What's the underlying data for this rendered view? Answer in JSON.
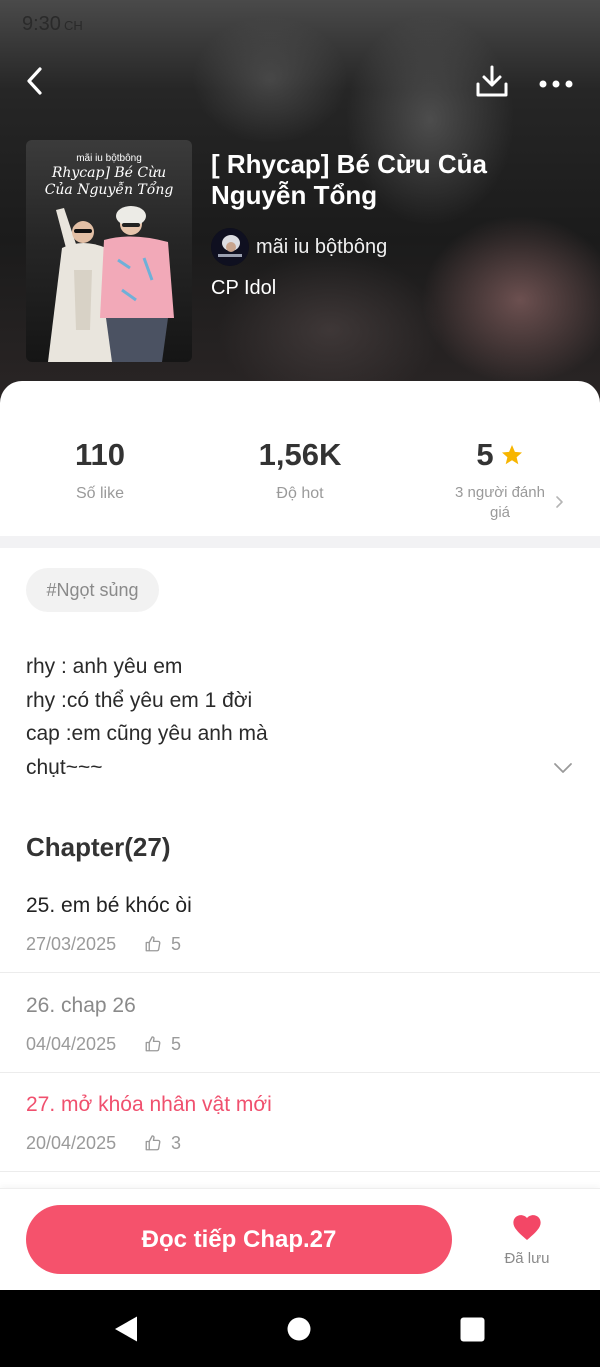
{
  "status_bar": {
    "time": "9:30",
    "period": "CH"
  },
  "header": {
    "title": "[ Rhycap] Bé Cừu Của Nguyễn Tổng",
    "author": "mãi iu bộtbông",
    "category": "CP Idol",
    "cover": {
      "author_line": "mãi iu bộtbông",
      "title_line1": "Rhycap] Bé Cừu",
      "title_line2": "Của Nguyễn Tổng"
    }
  },
  "stats": [
    {
      "value": "110",
      "label": "Số like"
    },
    {
      "value": "1,56K",
      "label": "Độ hot"
    },
    {
      "value": "5",
      "label": "3 người đánh giá"
    }
  ],
  "tags": [
    "#Ngọt sủng"
  ],
  "description": [
    "rhy : anh yêu em",
    "rhy :có thể yêu em 1 đời",
    "cap :em cũng yêu anh mà",
    "chụt~~~"
  ],
  "chapter_section": {
    "heading": "Chapter(27)"
  },
  "chapters": [
    {
      "title": "25. em bé khóc òi",
      "date": "27/03/2025",
      "likes": "5",
      "title_color": "#222222"
    },
    {
      "title": "26. chap 26",
      "date": "04/04/2025",
      "likes": "5",
      "title_color": "#8a8a8a"
    },
    {
      "title": "27. mở khóa nhân vật mới",
      "date": "20/04/2025",
      "likes": "3",
      "title_color": "#f0506e"
    }
  ],
  "bottom_bar": {
    "continue_button": "Đọc tiếp Chap.27",
    "saved_label": "Đã lưu"
  },
  "theme": {
    "accent": "#f5526c",
    "star": "#f7b500",
    "heart": "#f34766",
    "text": "#333333",
    "muted": "#9a9a9a"
  },
  "icons": {
    "back": "back-arrow-icon",
    "download": "download-icon",
    "more": "more-dots-icon",
    "rating": "star-icon",
    "ratings_link": "chevron-right-icon",
    "expand": "chevron-down-icon",
    "like": "thumb-up-icon",
    "saved": "heart-icon",
    "nav": [
      "nav-back-icon",
      "nav-home-icon",
      "nav-recents-icon"
    ]
  }
}
